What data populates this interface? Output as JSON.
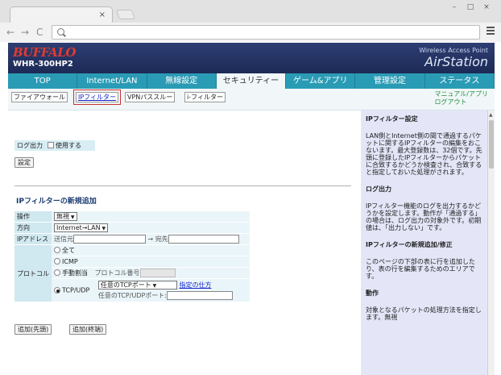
{
  "browser": {
    "tab_close": "×",
    "win_min": "–",
    "win_max": "□",
    "win_close": "×",
    "back": "←",
    "forward": "→",
    "reload": "C"
  },
  "header": {
    "brand": "BUFFALO",
    "model": "WHR-300HP2",
    "tagline": "Wireless Access Point",
    "product": "AirStation"
  },
  "nav": {
    "tabs": [
      "TOP",
      "Internet/LAN",
      "無線設定",
      "セキュリティー",
      "ゲーム&アプリ",
      "管理設定",
      "ステータス"
    ],
    "active_index": 3
  },
  "subnav": {
    "items": [
      "ファイアウォール",
      "IPフィルター",
      "VPNパススルー",
      "i-フィルター"
    ],
    "active_index": 1,
    "manual": "マニュアル/アプリ",
    "logout": "ログアウト"
  },
  "log": {
    "label": "ログ出力",
    "checkbox_label": "使用する",
    "save_button": "設定"
  },
  "new_entry": {
    "title": "IPフィルターの新規追加",
    "operation_label": "操作",
    "operation_value": "無視",
    "direction_label": "方向",
    "direction_value": "Internet→LAN",
    "ip_label": "IPアドレス",
    "src_label": "送信元",
    "dst_label": "→ 宛先",
    "protocol_label": "プロトコル",
    "proto_all": "全て",
    "proto_icmp": "ICMP",
    "proto_manual": "手動割当",
    "proto_number_label": "プロトコル番号",
    "proto_tcpudp": "TCP/UDP",
    "port_select": "任意のTCPポート",
    "how_to": "指定の仕方",
    "port_label": "任意のTCP/UDPポート:",
    "add_first_button": "追加(先頭)",
    "add_last_button": "追加(終端)"
  },
  "help": {
    "s1_title": "IPフィルター設定",
    "s1_body": "LAN側とInternet側の間で通過するパケットに関するIPフィルターの編集をおこないます。最大登録数は、32個です。先頭に登録したIPフィルターからパケットに合致するかどうか検査され、合致すると指定しておいた処理がされます。",
    "s2_title": "ログ出力",
    "s2_body": "IPフィルター機能のログを出力するかどうかを設定します。動作が「通過する」の場合は、ログ出力の対象外です。初期値は、「出力しない」です。",
    "s3_title": "IPフィルターの新規追加/修正",
    "s3_body": "このページの下部の表に行を追加したり、表の行を編集するためのエリアです。",
    "s4_title": "動作",
    "s4_body": "対象となるパケットの処理方法を指定します。無視"
  }
}
